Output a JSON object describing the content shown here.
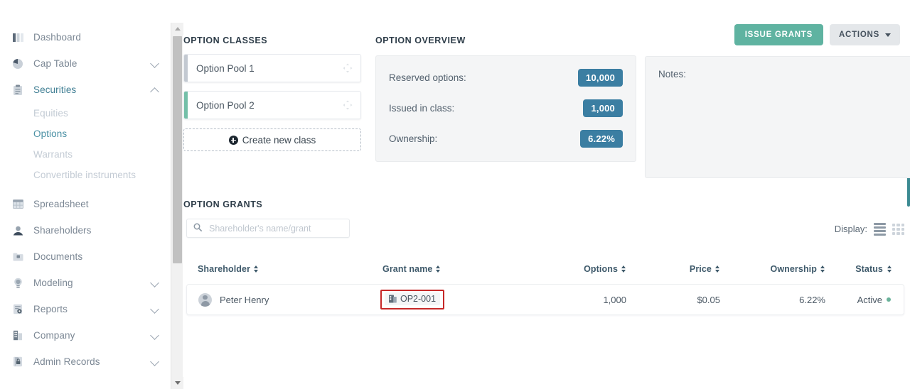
{
  "sidebar": {
    "items": [
      {
        "label": "Dashboard",
        "icon": "bar-chart-icon",
        "expandable": false,
        "active": false
      },
      {
        "label": "Cap Table",
        "icon": "pie-chart-icon",
        "expandable": true,
        "expanded": false,
        "active": false
      },
      {
        "label": "Securities",
        "icon": "clipboard-icon",
        "expandable": true,
        "expanded": true,
        "active": true
      },
      {
        "label": "Spreadsheet",
        "icon": "table-icon",
        "expandable": false,
        "active": false
      },
      {
        "label": "Shareholders",
        "icon": "user-icon",
        "expandable": false,
        "active": false
      },
      {
        "label": "Documents",
        "icon": "folder-icon",
        "expandable": false,
        "active": false
      },
      {
        "label": "Modeling",
        "icon": "lightbulb-icon",
        "expandable": true,
        "expanded": false,
        "active": false
      },
      {
        "label": "Reports",
        "icon": "report-icon",
        "expandable": true,
        "expanded": false,
        "active": false
      },
      {
        "label": "Company",
        "icon": "building-icon",
        "expandable": true,
        "expanded": false,
        "active": false
      },
      {
        "label": "Admin Records",
        "icon": "lock-records-icon",
        "expandable": true,
        "expanded": false,
        "active": false
      }
    ],
    "securities_subitems": [
      {
        "label": "Equities",
        "active": false
      },
      {
        "label": "Options",
        "active": true
      },
      {
        "label": "Warrants",
        "active": false
      },
      {
        "label": "Convertible instruments",
        "active": false
      }
    ]
  },
  "toolbar": {
    "issue_grants_label": "ISSUE GRANTS",
    "actions_label": "ACTIONS"
  },
  "option_classes": {
    "title": "OPTION CLASSES",
    "items": [
      {
        "name": "Option Pool 1",
        "accent": "#c3c9d1",
        "selected": false
      },
      {
        "name": "Option Pool 2",
        "accent": "#74bfa8",
        "selected": true
      }
    ],
    "create_label": "Create new class"
  },
  "option_overview": {
    "title": "OPTION OVERVIEW",
    "rows": [
      {
        "label": "Reserved options:",
        "value": "10,000"
      },
      {
        "label": "Issued in class:",
        "value": "1,000"
      },
      {
        "label": "Ownership:",
        "value": "6.22%"
      }
    ],
    "pill_color": "#3b7ea2"
  },
  "notes": {
    "label": "Notes:",
    "value": ""
  },
  "option_grants": {
    "title": "OPTION GRANTS",
    "search": {
      "placeholder": "Shareholder's name/grant",
      "value": ""
    },
    "display": {
      "label": "Display:",
      "list_view_selected": true,
      "grid_view_selected": false
    },
    "columns": [
      {
        "key": "shareholder",
        "label": "Shareholder",
        "sortable": true
      },
      {
        "key": "grant_name",
        "label": "Grant name",
        "sortable": true
      },
      {
        "key": "options",
        "label": "Options",
        "sortable": true
      },
      {
        "key": "price",
        "label": "Price",
        "sortable": true
      },
      {
        "key": "ownership",
        "label": "Ownership",
        "sortable": true
      },
      {
        "key": "status",
        "label": "Status",
        "sortable": true
      }
    ],
    "rows": [
      {
        "shareholder": "Peter Henry",
        "grant_name": "OP2-001",
        "options": "1,000",
        "price": "$0.05",
        "ownership": "6.22%",
        "status": "Active",
        "status_color": "#6bb39b",
        "highlighted": true,
        "highlight_color": "#c62828"
      }
    ]
  }
}
